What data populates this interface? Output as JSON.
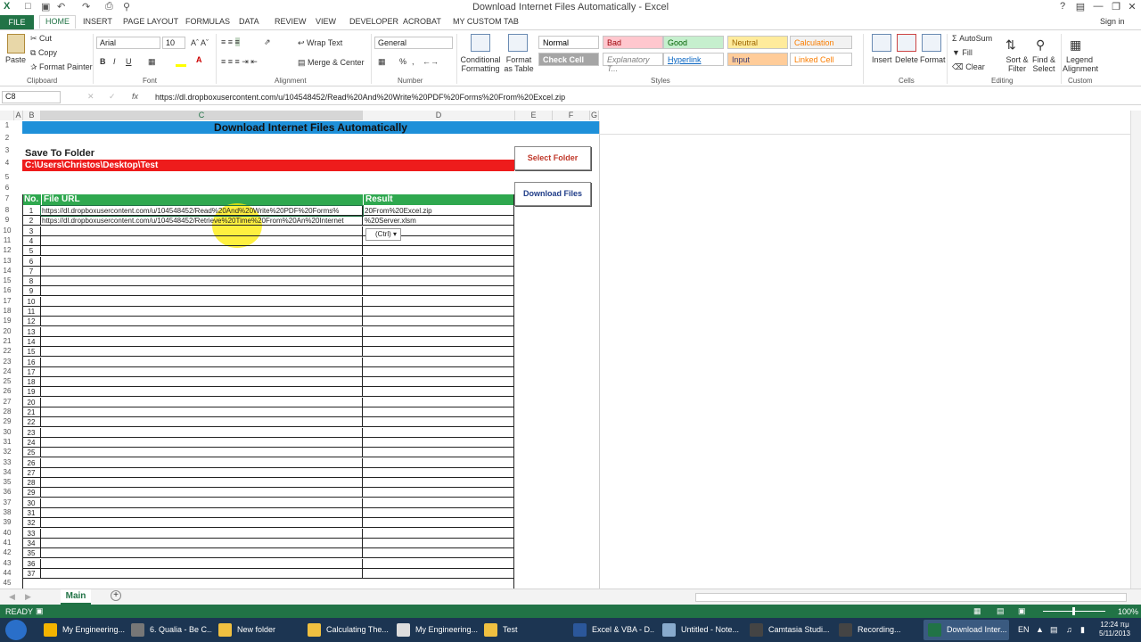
{
  "window": {
    "title": "Download Internet Files Automatically - Excel",
    "sign_in": "Sign in",
    "help": "?"
  },
  "tabs": [
    "FILE",
    "HOME",
    "INSERT",
    "PAGE LAYOUT",
    "FORMULAS",
    "DATA",
    "REVIEW",
    "VIEW",
    "DEVELOPER",
    "ACROBAT",
    "MY CUSTOM TAB"
  ],
  "ribbon": {
    "clipboard": {
      "paste": "Paste",
      "cut": "Cut",
      "copy": "Copy",
      "format_painter": "Format Painter",
      "label": "Clipboard"
    },
    "font": {
      "name": "Arial",
      "size": "10",
      "label": "Font",
      "bold": "B",
      "italic": "I",
      "underline": "U"
    },
    "alignment": {
      "wrap_text": "Wrap Text",
      "merge_center": "Merge & Center",
      "label": "Alignment"
    },
    "number": {
      "format": "General",
      "label": "Number",
      "percent": "%",
      "comma": ","
    },
    "styles": {
      "conditional": "Conditional Formatting",
      "format_table": "Format as Table",
      "label": "Styles",
      "cells": [
        {
          "text": "Normal",
          "bg": "#ffffff",
          "color": "#000000"
        },
        {
          "text": "Bad",
          "bg": "#ffc7ce",
          "color": "#9c0006"
        },
        {
          "text": "Good",
          "bg": "#c6efce",
          "color": "#006100"
        },
        {
          "text": "Neutral",
          "bg": "#ffeb9c",
          "color": "#9c6500"
        },
        {
          "text": "Calculation",
          "bg": "#f2f2f2",
          "color": "#fa7d00"
        },
        {
          "text": "Check Cell",
          "bg": "#a5a5a5",
          "color": "#ffffff"
        },
        {
          "text": "Explanatory T...",
          "bg": "#ffffff",
          "color": "#7f7f7f"
        },
        {
          "text": "Hyperlink",
          "bg": "#ffffff",
          "color": "#0563c1"
        },
        {
          "text": "Input",
          "bg": "#ffcc99",
          "color": "#3f3f76"
        },
        {
          "text": "Linked Cell",
          "bg": "#ffffff",
          "color": "#fa7d00"
        }
      ]
    },
    "cells": {
      "insert": "Insert",
      "delete": "Delete",
      "format": "Format",
      "label": "Cells"
    },
    "editing": {
      "autosum": "AutoSum",
      "fill": "Fill",
      "clear": "Clear",
      "sort_filter": "Sort & Filter",
      "find_select": "Find & Select",
      "label": "Editing"
    },
    "custom": {
      "legend": "Legend Alignment",
      "label": "Custom"
    }
  },
  "formula_bar": {
    "name_box": "C8",
    "fx": "fx",
    "content": "https://dl.dropboxusercontent.com/u/104548452/Read%20And%20Write%20PDF%20Forms%20From%20Excel.zip"
  },
  "columns": [
    "A",
    "B",
    "C",
    "D",
    "E",
    "F",
    "G"
  ],
  "sheet": {
    "banner": "Download Internet Files Automatically",
    "save_to_folder": "Save To Folder",
    "folder_path": "C:\\Users\\Christos\\Desktop\\Test",
    "select_folder_button": "Select Folder",
    "download_button": "Download Files",
    "headers": {
      "no": "No.",
      "url": "File URL",
      "result": "Result"
    },
    "rows": [
      {
        "no": "1",
        "url": "https://dl.dropboxusercontent.com/u/104548452/Read%20And%20Write%20PDF%20Forms%",
        "result": "20From%20Excel.zip"
      },
      {
        "no": "2",
        "url": "https://dl.dropboxusercontent.com/u/104548452/Retrieve%20Time%20From%20An%20Internet",
        "result": "%20Server.xlsm"
      },
      {
        "no": "3",
        "url": "",
        "result": ""
      },
      {
        "no": "4",
        "url": "",
        "result": ""
      },
      {
        "no": "5",
        "url": "",
        "result": ""
      },
      {
        "no": "6",
        "url": "",
        "result": ""
      },
      {
        "no": "7",
        "url": "",
        "result": ""
      },
      {
        "no": "8",
        "url": "",
        "result": ""
      },
      {
        "no": "9",
        "url": "",
        "result": ""
      },
      {
        "no": "10",
        "url": "",
        "result": ""
      },
      {
        "no": "11",
        "url": "",
        "result": ""
      },
      {
        "no": "12",
        "url": "",
        "result": ""
      },
      {
        "no": "13",
        "url": "",
        "result": ""
      },
      {
        "no": "14",
        "url": "",
        "result": ""
      },
      {
        "no": "15",
        "url": "",
        "result": ""
      },
      {
        "no": "16",
        "url": "",
        "result": ""
      },
      {
        "no": "17",
        "url": "",
        "result": ""
      },
      {
        "no": "18",
        "url": "",
        "result": ""
      },
      {
        "no": "19",
        "url": "",
        "result": ""
      },
      {
        "no": "20",
        "url": "",
        "result": ""
      },
      {
        "no": "21",
        "url": "",
        "result": ""
      },
      {
        "no": "22",
        "url": "",
        "result": ""
      },
      {
        "no": "23",
        "url": "",
        "result": ""
      },
      {
        "no": "24",
        "url": "",
        "result": ""
      },
      {
        "no": "25",
        "url": "",
        "result": ""
      },
      {
        "no": "26",
        "url": "",
        "result": ""
      },
      {
        "no": "27",
        "url": "",
        "result": ""
      },
      {
        "no": "28",
        "url": "",
        "result": ""
      },
      {
        "no": "29",
        "url": "",
        "result": ""
      },
      {
        "no": "30",
        "url": "",
        "result": ""
      },
      {
        "no": "31",
        "url": "",
        "result": ""
      },
      {
        "no": "32",
        "url": "",
        "result": ""
      },
      {
        "no": "33",
        "url": "",
        "result": ""
      },
      {
        "no": "34",
        "url": "",
        "result": ""
      },
      {
        "no": "35",
        "url": "",
        "result": ""
      },
      {
        "no": "36",
        "url": "",
        "result": ""
      },
      {
        "no": "37",
        "url": "",
        "result": ""
      },
      {
        "no": "38",
        "url": "",
        "result": ""
      }
    ],
    "row_numbers": [
      "1",
      "2",
      "3",
      "4",
      "5",
      "6",
      "7",
      "8",
      "9",
      "10",
      "11",
      "12",
      "13",
      "14",
      "15",
      "16",
      "17",
      "18",
      "19",
      "20",
      "21",
      "22",
      "23",
      "24",
      "25",
      "26",
      "27",
      "28",
      "29",
      "30",
      "31",
      "32",
      "33",
      "34",
      "35",
      "36",
      "37",
      "38",
      "39",
      "40",
      "41",
      "42",
      "43",
      "44",
      "45",
      "46"
    ],
    "paste_options": "(Ctrl)"
  },
  "sheet_tabs": {
    "active": "Main",
    "add": "+"
  },
  "status": {
    "ready": "READY",
    "zoom": "100%"
  },
  "taskbar": {
    "items": [
      {
        "label": "My Engineering...",
        "color": "#f4b400"
      },
      {
        "label": "6. Qualia - Be C...",
        "color": "#777777"
      },
      {
        "label": "New folder",
        "color": "#f0c040"
      },
      {
        "label": "Calculating The...",
        "color": "#f0c040"
      },
      {
        "label": "My Engineering...",
        "color": "#dddddd"
      },
      {
        "label": "Test",
        "color": "#f0c040"
      },
      {
        "label": "Excel & VBA - D...",
        "color": "#2b579a"
      },
      {
        "label": "Untitled - Note...",
        "color": "#88aacc"
      },
      {
        "label": "Camtasia Studi...",
        "color": "#444444"
      },
      {
        "label": "Recording...",
        "color": "#444444"
      },
      {
        "label": "Download Inter...",
        "color": "#217346"
      }
    ],
    "lang": "EN",
    "time": "12:24 πμ",
    "date": "5/11/2013"
  },
  "colors": {
    "accent": "#217346",
    "banner": "#1e90d9",
    "folder": "#ee1c1c",
    "header": "#2fa84f"
  }
}
